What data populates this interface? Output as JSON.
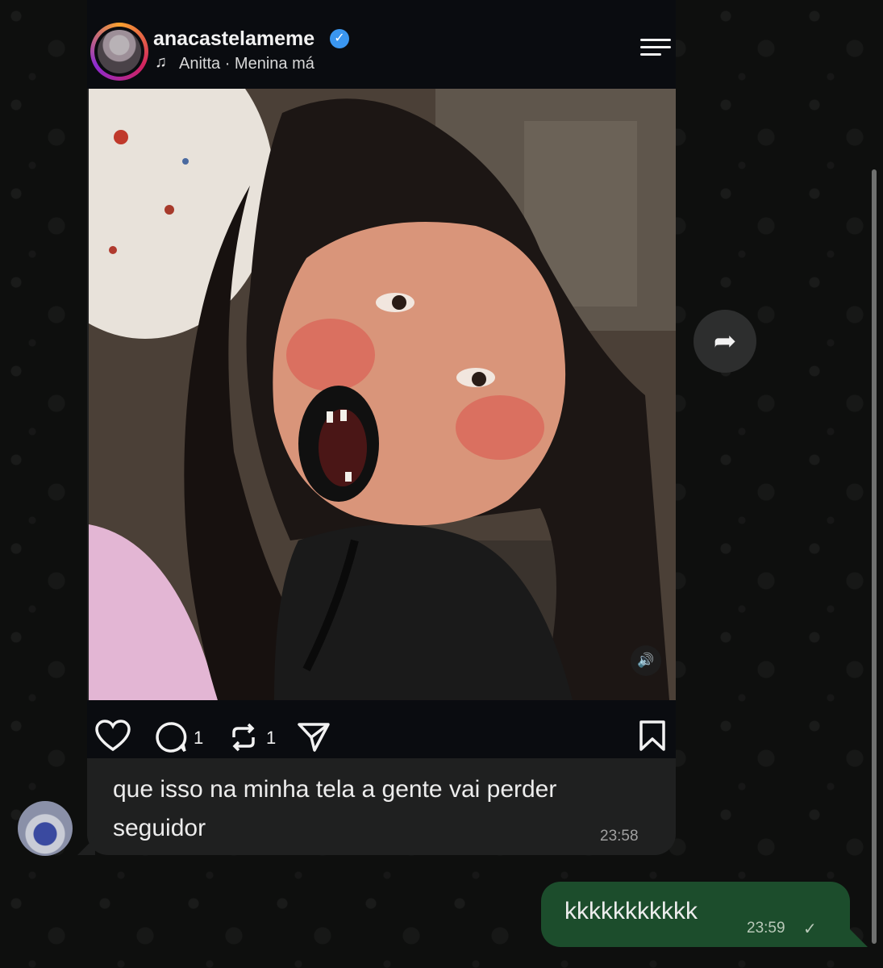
{
  "post": {
    "username": "anacastelameme",
    "music_icon": "music-note-icon",
    "music_text": "Anitta · Menina má",
    "comments_count": "1",
    "reposts_count": "1"
  },
  "incoming_message": {
    "text": "que isso na minha tela a gente vai perder seguidor",
    "time": "23:58"
  },
  "outgoing_message": {
    "text": "kkkkkkkkkkk",
    "time": "23:59",
    "status_icon": "✓"
  },
  "icons": {
    "verified": "✓",
    "sound": "🔊",
    "forward": "➦"
  },
  "colors": {
    "incoming_bubble": "#1f2020",
    "outgoing_bubble": "#1c4d2c",
    "verified_badge": "#3a96f0"
  }
}
